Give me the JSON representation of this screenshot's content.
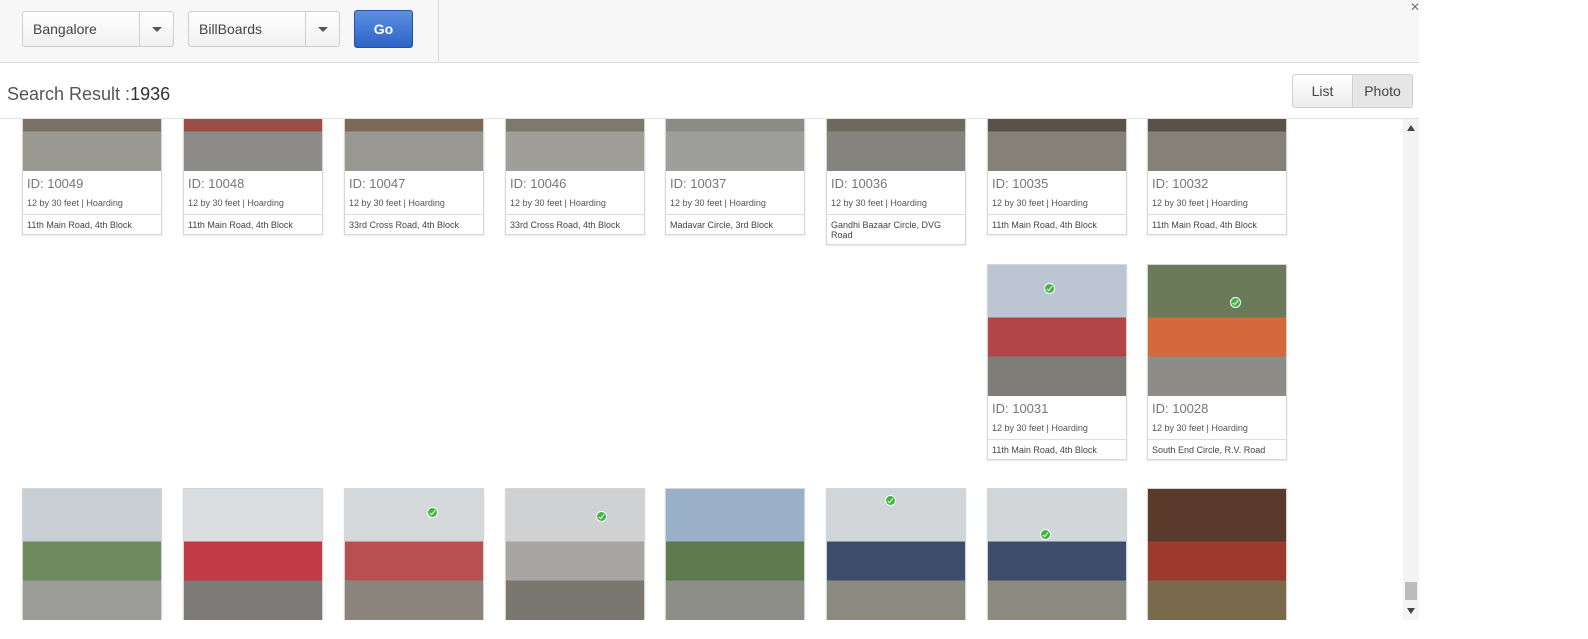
{
  "filters": {
    "city": "Bangalore",
    "media_type": "BillBoards",
    "go_label": "Go"
  },
  "results": {
    "label": "Search Result :",
    "count": "1936"
  },
  "view_toggle": {
    "list_label": "List",
    "photo_label": "Photo"
  },
  "cards": [
    {
      "id": "ID: 10049",
      "spec": "12 by 30 feet | Hoarding",
      "location": "11th Main Road, 4th Block",
      "checked": false,
      "img_colors": [
        "#8fa3b3",
        "#7a7266",
        "#9b9a92"
      ]
    },
    {
      "id": "ID: 10048",
      "spec": "12 by 30 feet | Hoarding",
      "location": "11th Main Road, 4th Block",
      "checked": false,
      "img_colors": [
        "#a9a6a0",
        "#9c4d45",
        "#8d8c88"
      ]
    },
    {
      "id": "ID: 10047",
      "spec": "12 by 30 feet | Hoarding",
      "location": "33rd Cross Road, 4th Block",
      "checked": false,
      "img_colors": [
        "#b1aa9e",
        "#7b6a58",
        "#9a9892"
      ]
    },
    {
      "id": "ID: 10046",
      "spec": "12 by 30 feet | Hoarding",
      "location": "33rd Cross Road, 4th Block",
      "checked": false,
      "img_colors": [
        "#b8b8b0",
        "#7d7a6d",
        "#a09e98"
      ]
    },
    {
      "id": "ID: 10037",
      "spec": "12 by 30 feet | Hoarding",
      "location": "Madavar Circle, 3rd Block",
      "checked": false,
      "img_colors": [
        "#b2b5b0",
        "#8a8c86",
        "#9e9f9a"
      ]
    },
    {
      "id": "ID: 10036",
      "spec": "12 by 30 feet | Hoarding",
      "location": "Gandhi Bazaar Circle, DVG Road",
      "checked": false,
      "img_colors": [
        "#9a9a94",
        "#6f6a60",
        "#85847f"
      ]
    },
    {
      "id": "ID: 10035",
      "spec": "12 by 30 feet | Hoarding",
      "location": "11th Main Road, 4th Block",
      "checked": false,
      "img_colors": [
        "#8b3a36",
        "#5a5248",
        "#858078"
      ]
    },
    {
      "id": "ID: 10032",
      "spec": "12 by 30 feet | Hoarding",
      "location": "11th Main Road, 4th Block",
      "checked": false,
      "img_colors": [
        "#8b3a36",
        "#5a5248",
        "#858078"
      ]
    },
    {
      "id": "ID: 10031",
      "spec": "12 by 30 feet | Hoarding",
      "location": "11th Main Road, 4th Block",
      "checked": true,
      "img_colors": [
        "#bcc6d2",
        "#b24646",
        "#7f7d78"
      ]
    },
    {
      "id": "ID: 10028",
      "spec": "12 by 30 feet | Hoarding",
      "location": "South End Circle, R.V. Road",
      "checked": true,
      "img_colors": [
        "#6b7b5a",
        "#d46a3c",
        "#8e8c86"
      ]
    },
    {
      "id": "",
      "spec": "",
      "location": "",
      "checked": false,
      "img_colors": [
        "#c9cfd4",
        "#6f8a5c",
        "#9c9c98"
      ]
    },
    {
      "id": "",
      "spec": "",
      "location": "",
      "checked": false,
      "img_colors": [
        "#d9dde0",
        "#c23a45",
        "#7d7b78"
      ]
    },
    {
      "id": "",
      "spec": "",
      "location": "",
      "checked": true,
      "img_colors": [
        "#d5d8da",
        "#b95050",
        "#8a847c"
      ]
    },
    {
      "id": "",
      "spec": "",
      "location": "",
      "checked": true,
      "img_colors": [
        "#cfd1d2",
        "#a7a6a2",
        "#7a7770"
      ]
    },
    {
      "id": "",
      "spec": "",
      "location": "",
      "checked": false,
      "img_colors": [
        "#9ab0c8",
        "#5f7a4c",
        "#8d8e88"
      ]
    },
    {
      "id": "",
      "spec": "",
      "location": "",
      "checked": true,
      "img_colors": [
        "#d2d6d8",
        "#3f4d6d",
        "#8b8a80"
      ]
    },
    {
      "id": "",
      "spec": "",
      "location": "",
      "checked": true,
      "img_colors": [
        "#d2d6d8",
        "#3f4d6d",
        "#8b8a80"
      ]
    },
    {
      "id": "",
      "spec": "",
      "location": "",
      "checked": false,
      "img_colors": [
        "#5a3a2a",
        "#9c3a2e",
        "#7a6a4c"
      ]
    }
  ]
}
